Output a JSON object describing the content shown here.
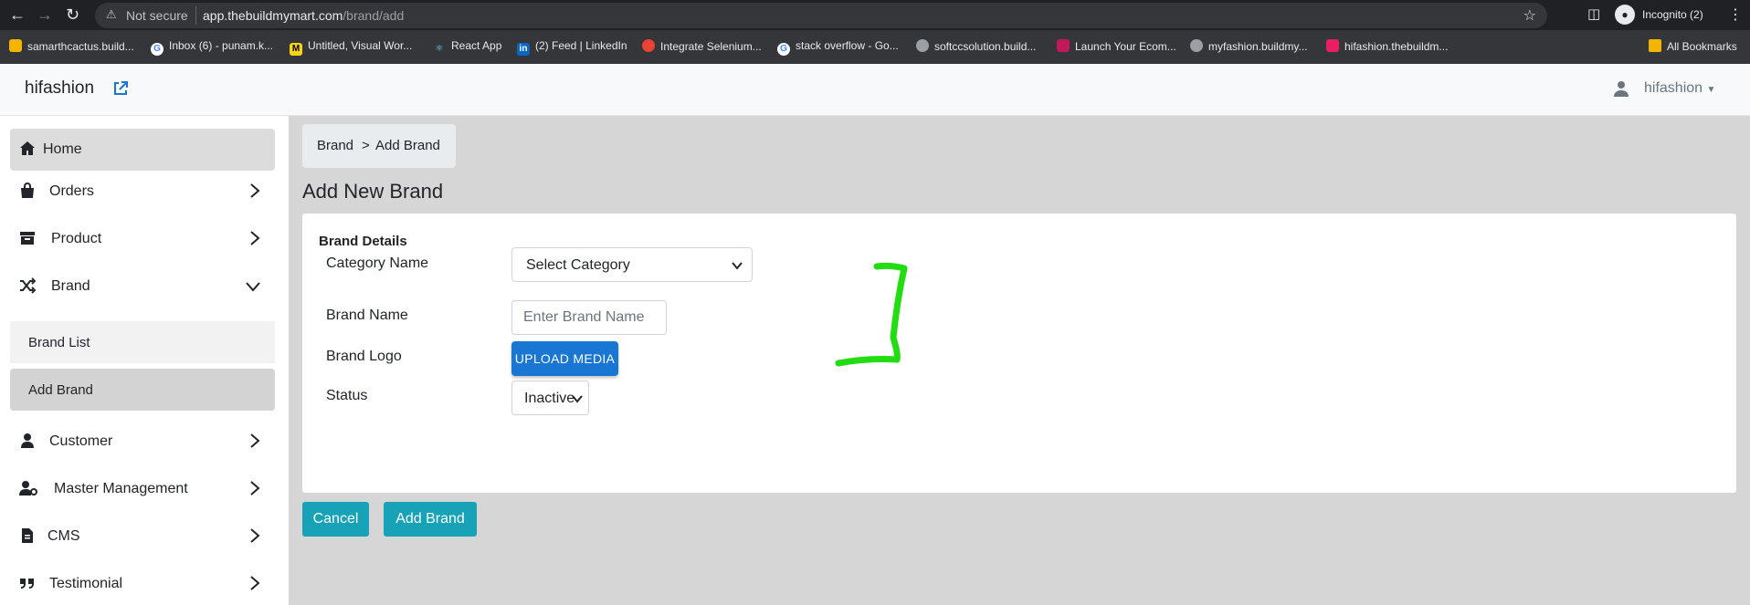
{
  "browser": {
    "not_secure": "Not secure",
    "url_host": "app.thebuildmymart.com",
    "url_path": "/brand/add",
    "profile": "Incognito (2)",
    "bookmarks": [
      {
        "label": "samarthcactus.build...",
        "color": "#f4b400"
      },
      {
        "label": "Inbox (6) - punam.k...",
        "color": "#4285f4"
      },
      {
        "label": "Untitled, Visual Wor...",
        "color": "#f7d417"
      },
      {
        "label": "React App",
        "color": "#61dafb"
      },
      {
        "label": "(2) Feed | LinkedIn",
        "color": "#0a66c2"
      },
      {
        "label": "Integrate Selenium...",
        "color": "#ea4335"
      },
      {
        "label": "stack overflow - Go...",
        "color": "#4285f4"
      },
      {
        "label": "softccsolution.build...",
        "color": "#9aa0a6"
      },
      {
        "label": "Launch Your Ecom...",
        "color": "#c2185b"
      },
      {
        "label": "myfashion.buildmy...",
        "color": "#9aa0a6"
      },
      {
        "label": "hifashion.thebuildm...",
        "color": "#e91e63"
      }
    ],
    "all_bookmarks": "All Bookmarks"
  },
  "header": {
    "app_name": "hifashion",
    "user": "hifashion"
  },
  "sidebar": {
    "items": [
      {
        "label": "Home"
      },
      {
        "label": "Orders"
      },
      {
        "label": "Product"
      },
      {
        "label": "Brand"
      },
      {
        "label": "Customer"
      },
      {
        "label": "Master Management"
      },
      {
        "label": "CMS"
      },
      {
        "label": "Testimonial"
      }
    ],
    "brand_sub": [
      {
        "label": "Brand List"
      },
      {
        "label": "Add Brand"
      }
    ]
  },
  "main": {
    "breadcrumb_parent": "Brand",
    "breadcrumb_sep": ">",
    "breadcrumb_current": "Add Brand",
    "page_title": "Add New Brand",
    "card_title": "Brand Details",
    "category_label": "Category Name",
    "category_value": "Select Category",
    "brand_name_label": "Brand Name",
    "brand_name_placeholder": "Enter Brand Name",
    "brand_logo_label": "Brand Logo",
    "upload_label": "UPLOAD MEDIA",
    "status_label": "Status",
    "status_value": "Inactive",
    "cancel_label": "Cancel",
    "add_label": "Add Brand"
  },
  "colors": {
    "accent": "#17a2b8",
    "upload": "#1976d2",
    "annotation": "#22dd11"
  }
}
